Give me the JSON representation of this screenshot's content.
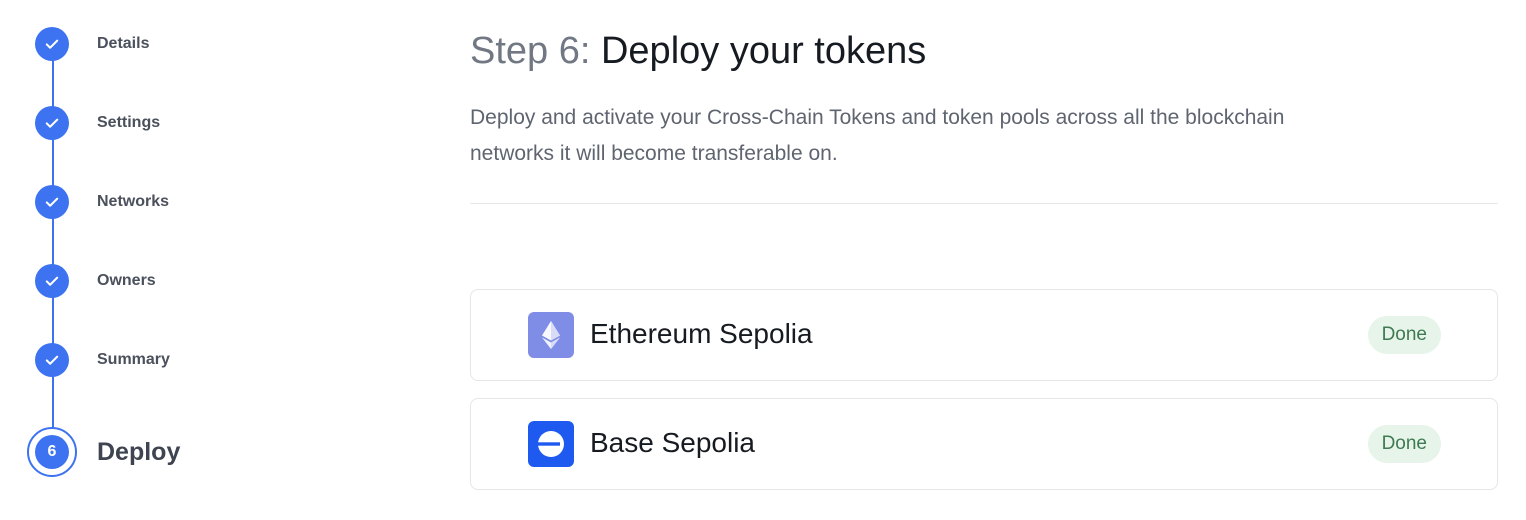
{
  "stepper": {
    "completed_steps": [
      {
        "label": "Details"
      },
      {
        "label": "Settings"
      },
      {
        "label": "Networks"
      },
      {
        "label": "Owners"
      },
      {
        "label": "Summary"
      }
    ],
    "current_step": {
      "number": "6",
      "label": "Deploy"
    }
  },
  "main": {
    "title_prefix": "Step 6:",
    "title_rest": "Deploy your tokens",
    "description": "Deploy and activate your Cross-Chain Tokens and token pools across all the blockchain networks it will become transferable on.",
    "networks": [
      {
        "name": "Ethereum Sepolia",
        "status": "Done",
        "icon": "ethereum-icon",
        "logo_color": "#7f8de6"
      },
      {
        "name": "Base Sepolia",
        "status": "Done",
        "icon": "base-icon",
        "logo_color": "#1f5af0"
      }
    ]
  },
  "colors": {
    "accent": "#3d73f0",
    "done_badge_bg": "#e6f4e9",
    "done_badge_text": "#3e7a52"
  }
}
